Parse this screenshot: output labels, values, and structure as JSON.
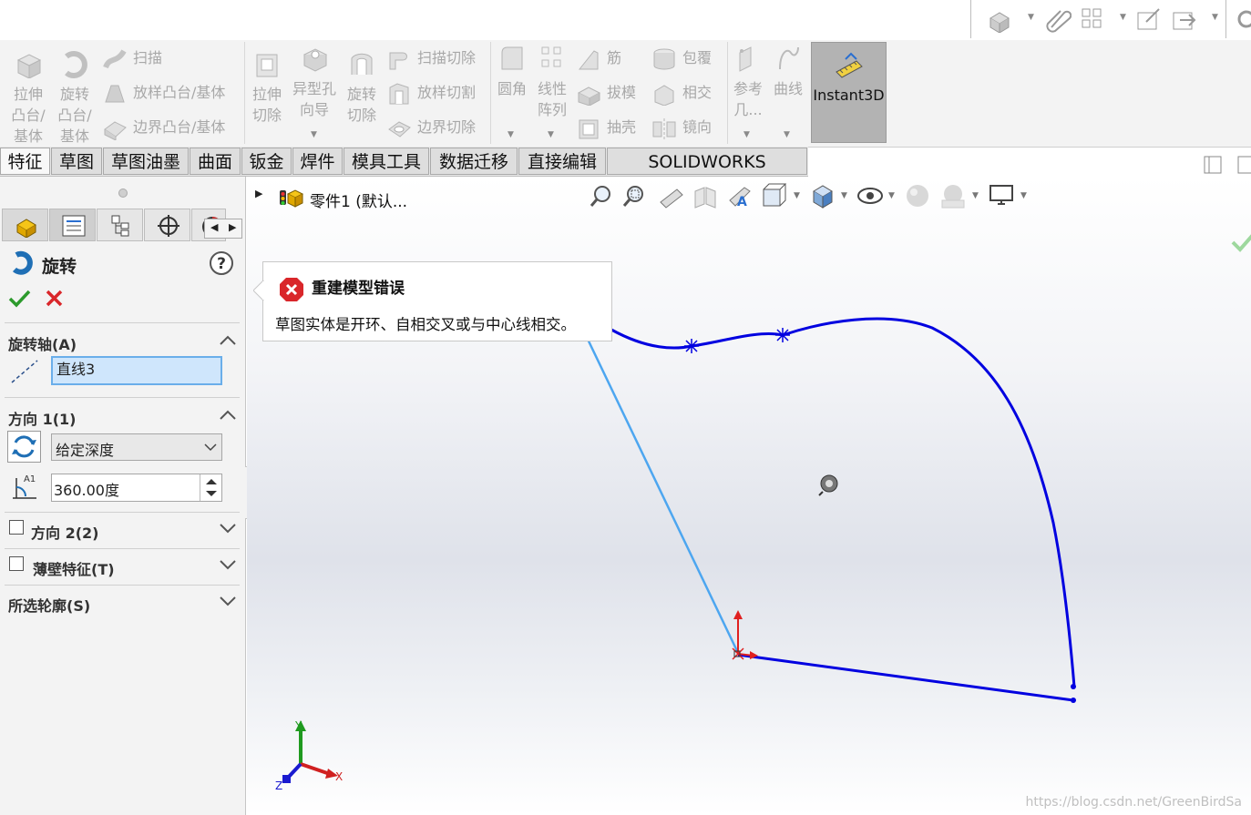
{
  "ribbon": {
    "extrude_boss": [
      "拉伸",
      "凸台/",
      "基体"
    ],
    "revolve_boss": [
      "旋转",
      "凸台/",
      "基体"
    ],
    "sweep": "扫描",
    "loft_boss": "放样凸台/基体",
    "boundary_boss": "边界凸台/基体",
    "extrude_cut": [
      "拉伸",
      "切除"
    ],
    "hole_wizard": [
      "异型孔",
      "向导"
    ],
    "revolve_cut": [
      "旋转",
      "切除"
    ],
    "swept_cut": "扫描切除",
    "lofted_cut": "放样切割",
    "boundary_cut": "边界切除",
    "fillet": "圆角",
    "linear_pattern": [
      "线性",
      "阵列"
    ],
    "rib": "筋",
    "draft": "拔模",
    "shell": "抽壳",
    "wrap": "包覆",
    "intersect": "相交",
    "mirror": "镜向",
    "reference": [
      "参考",
      "几..."
    ],
    "curves": "曲线",
    "instant3d": "Instant3D"
  },
  "tabs": [
    "特征",
    "草图",
    "草图油墨",
    "曲面",
    "钣金",
    "焊件",
    "模具工具",
    "数据迁移",
    "直接编辑",
    "SOLIDWORKS Inspection"
  ],
  "tree": {
    "part_label": "零件1  (默认..."
  },
  "property_manager": {
    "title": "旋转",
    "axis_section": "旋转轴(A)",
    "axis_value": "直线3",
    "dir1_section": "方向 1(1)",
    "end_condition": "给定深度",
    "angle_value": "360.00度",
    "dir2_section": "方向 2(2)",
    "thin_section": "薄壁特征(T)",
    "contours_section": "所选轮廓(S)"
  },
  "tooltip": {
    "title": "重建模型错误",
    "message": "草图实体是开环、自相交叉或与中心线相交。"
  },
  "triad": {
    "x": "X",
    "y": "Y",
    "z": "Z"
  },
  "watermark": "https://blog.csdn.net/GreenBirdSa",
  "colors": {
    "sketch_curve": "#0000e0",
    "centerline": "#4da6f0",
    "error_red": "#d9262a",
    "accept_green": "#2c9a2c",
    "instant3d_bg": "#b3b3b3"
  }
}
